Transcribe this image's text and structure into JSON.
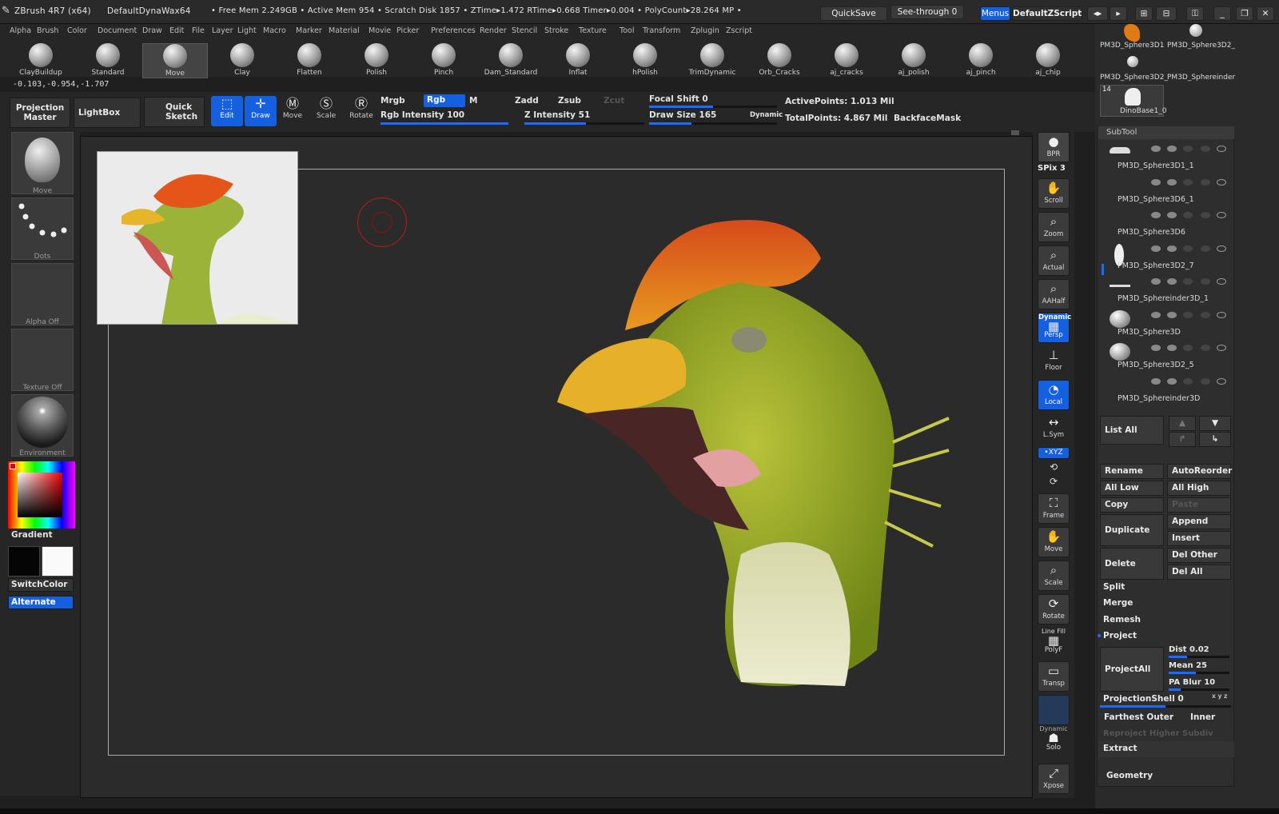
{
  "titlebar": {
    "app": "ZBrush 4R7 (x64)",
    "material": "DefaultDynaWax64",
    "stats": "• Free Mem 2.249GB • Active Mem 954 • Scratch Disk 1857 •  ZTime▸1.472 RTime▸0.668 Timer▸0.004 • PolyCount▸28.264 MP • ",
    "quicksave": "QuickSave",
    "see_through": "See-through  0",
    "menus": "Menus",
    "script": "DefaultZScript"
  },
  "menubar": [
    "Alpha",
    "Brush",
    "Color",
    "Document",
    "Draw",
    "Edit",
    "File",
    "Layer",
    "Light",
    "Macro",
    "Marker",
    "Material",
    "Movie",
    "Picker",
    "Preferences",
    "Render",
    "Stencil",
    "Stroke",
    "Texture",
    "Tool",
    "Transform",
    "Zplugin",
    "Zscript"
  ],
  "brushes": [
    "ClayBuildup",
    "Standard",
    "Move",
    "Clay",
    "Flatten",
    "Polish",
    "Pinch",
    "Dam_Standard",
    "Inflat",
    "hPolish",
    "TrimDynamic",
    "Orb_Cracks",
    "aj_cracks",
    "aj_polish",
    "aj_pinch",
    "aj_chip"
  ],
  "coords": "-0.103,-0.954,-1.707",
  "topctl": {
    "projection": "Projection Master",
    "lightbox": "LightBox",
    "quicksketch": "Quick Sketch",
    "edit": "Edit",
    "draw": "Draw",
    "move": "Move",
    "scale": "Scale",
    "rotate": "Rotate",
    "mrgb": "Mrgb",
    "rgb": "Rgb",
    "m": "M",
    "zadd": "Zadd",
    "zsub": "Zsub",
    "zcut": "Zcut",
    "rgb_int": "Rgb  Intensity 100",
    "z_int": "Z  Intensity 51",
    "focal": "Focal Shift 0",
    "drawsize": "Draw Size 165",
    "dynamic": "Dynamic",
    "activepts": "ActivePoints: 1.013  Mil",
    "totalpts": "TotalPoints: 4.867  Mil",
    "backface": "BackfaceMask",
    "rgb_int_value": 100,
    "z_int_value": 51,
    "focal_value": 0,
    "drawsize_value": 165
  },
  "left": {
    "move": "Move",
    "dots": "Dots",
    "alpha": "Alpha  Off",
    "texture": "Texture  Off",
    "environment": "Environment",
    "gradient": "Gradient",
    "switch": "SwitchColor",
    "alternate": "Alternate"
  },
  "rshelf": {
    "bpr": "BPR",
    "spix": "SPix 3",
    "scroll": "Scroll",
    "zoom": "Zoom",
    "actual": "Actual",
    "aahalf": "AAHalf",
    "persp_top": "Dynamic",
    "persp": "Persp",
    "floor": "Floor",
    "local": "Local",
    "lsym": "L.Sym",
    "xyz": "•XYZ",
    "frame": "Frame",
    "move": "Move",
    "scale": "Scale",
    "rotate": "Rotate",
    "linefill": "Line Fill",
    "polyf": "PolyF",
    "transp": "Transp",
    "dyn2": "Dynamic",
    "solo": "Solo",
    "xpose": "Xpose"
  },
  "rpanel": {
    "t1": "PM3D_Sphere3D1",
    "t2": "PM3D_Sphere3D2_",
    "t3": "PM3D_Sphere3D2_",
    "t4": "PM3D_Sphereinder",
    "t5": "DinoBase1_0",
    "t5n": "14",
    "subtool": "SubTool",
    "subs": [
      "PM3D_Sphere3D1_1",
      "PM3D_Sphere3D6_1",
      "PM3D_Sphere3D6",
      "PM3D_Sphere3D2_7",
      "PM3D_Sphereinder3D_1",
      "PM3D_Sphere3D",
      "PM3D_Sphere3D2_5",
      "PM3D_Sphereinder3D"
    ],
    "listall": "List All",
    "rename": "Rename",
    "autoreorder": "AutoReorder",
    "alllow": "All Low",
    "allhigh": "All High",
    "copy": "Copy",
    "paste": "Paste",
    "duplicate": "Duplicate",
    "append": "Append",
    "insert": "Insert",
    "delete": "Delete",
    "delother": "Del Other",
    "delall": "Del All",
    "split": "Split",
    "merge": "Merge",
    "remesh": "Remesh",
    "project": "Project",
    "projectall": "ProjectAll",
    "dist": "Dist 0.02",
    "mean": "Mean 25",
    "pablur": "PA  Blur 10",
    "shell": "ProjectionShell 0",
    "xyz": "x y z",
    "farthest": "Farthest  Outer",
    "inner": "Inner",
    "reproject": "Reproject Higher Subdiv",
    "extract": "Extract",
    "geometry": "Geometry"
  },
  "colors": {
    "accent": "#1560e0",
    "bg": "#1f1f1f",
    "panel": "#2a2a2a"
  }
}
